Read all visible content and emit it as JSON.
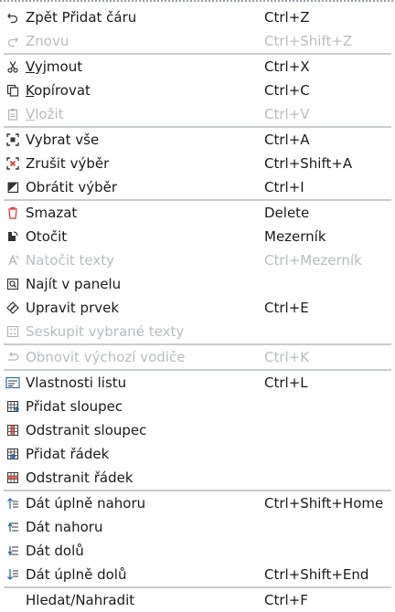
{
  "menu": {
    "undo": {
      "label": "Zpět Přidat čáru",
      "shortcut": "Ctrl+Z"
    },
    "redo": {
      "label": "Znovu",
      "shortcut": "Ctrl+Shift+Z"
    },
    "cut": {
      "label_u": "V",
      "label_rest": "yjmout",
      "shortcut": "Ctrl+X"
    },
    "copy": {
      "label_u": "K",
      "label_rest": "opírovat",
      "shortcut": "Ctrl+C"
    },
    "paste": {
      "label_u": "V",
      "label_rest": "ložit",
      "shortcut": "Ctrl+V"
    },
    "select_all": {
      "label": "Vybrat vše",
      "shortcut": "Ctrl+A"
    },
    "deselect": {
      "label": "Zrušit výběr",
      "shortcut": "Ctrl+Shift+A"
    },
    "invert": {
      "label": "Obrátit výběr",
      "shortcut": "Ctrl+I"
    },
    "delete": {
      "label": "Smazat",
      "shortcut": "Delete"
    },
    "rotate": {
      "label": "Otočit",
      "shortcut": "Mezerník"
    },
    "rotate_texts": {
      "label": "Natočit texty",
      "shortcut": "Ctrl+Mezerník"
    },
    "find_panel": {
      "label": "Najít v panelu",
      "shortcut": ""
    },
    "edit_item": {
      "label": "Upravit prvek",
      "shortcut": "Ctrl+E"
    },
    "group_texts": {
      "label": "Seskupit vybrané texty",
      "shortcut": ""
    },
    "restore_guides": {
      "label": "Obnovit výchozí vodiče",
      "shortcut": "Ctrl+K"
    },
    "sheet_props": {
      "label": "Vlastnosti listu",
      "shortcut": "Ctrl+L"
    },
    "add_column": {
      "label": "Přidat sloupec",
      "shortcut": ""
    },
    "remove_column": {
      "label": "Odstranit sloupec",
      "shortcut": ""
    },
    "add_row": {
      "label": "Přidat řádek",
      "shortcut": ""
    },
    "remove_row": {
      "label": "Odstranit řádek",
      "shortcut": ""
    },
    "bring_front": {
      "label": "Dát úplně nahoru",
      "shortcut": "Ctrl+Shift+Home"
    },
    "raise": {
      "label": "Dát nahoru",
      "shortcut": ""
    },
    "lower": {
      "label": "Dát dolů",
      "shortcut": ""
    },
    "send_back": {
      "label": "Dát úplně dolů",
      "shortcut": "Ctrl+Shift+End"
    },
    "find_replace": {
      "label": "Hledat/Nahradit",
      "shortcut": "Ctrl+F"
    }
  },
  "colors": {
    "separator": "#c8ccd0",
    "disabled_text": "#b8bcc0",
    "text": "#1a1a1a",
    "accent_red": "#d9342b",
    "accent_blue": "#2b6cb0"
  }
}
